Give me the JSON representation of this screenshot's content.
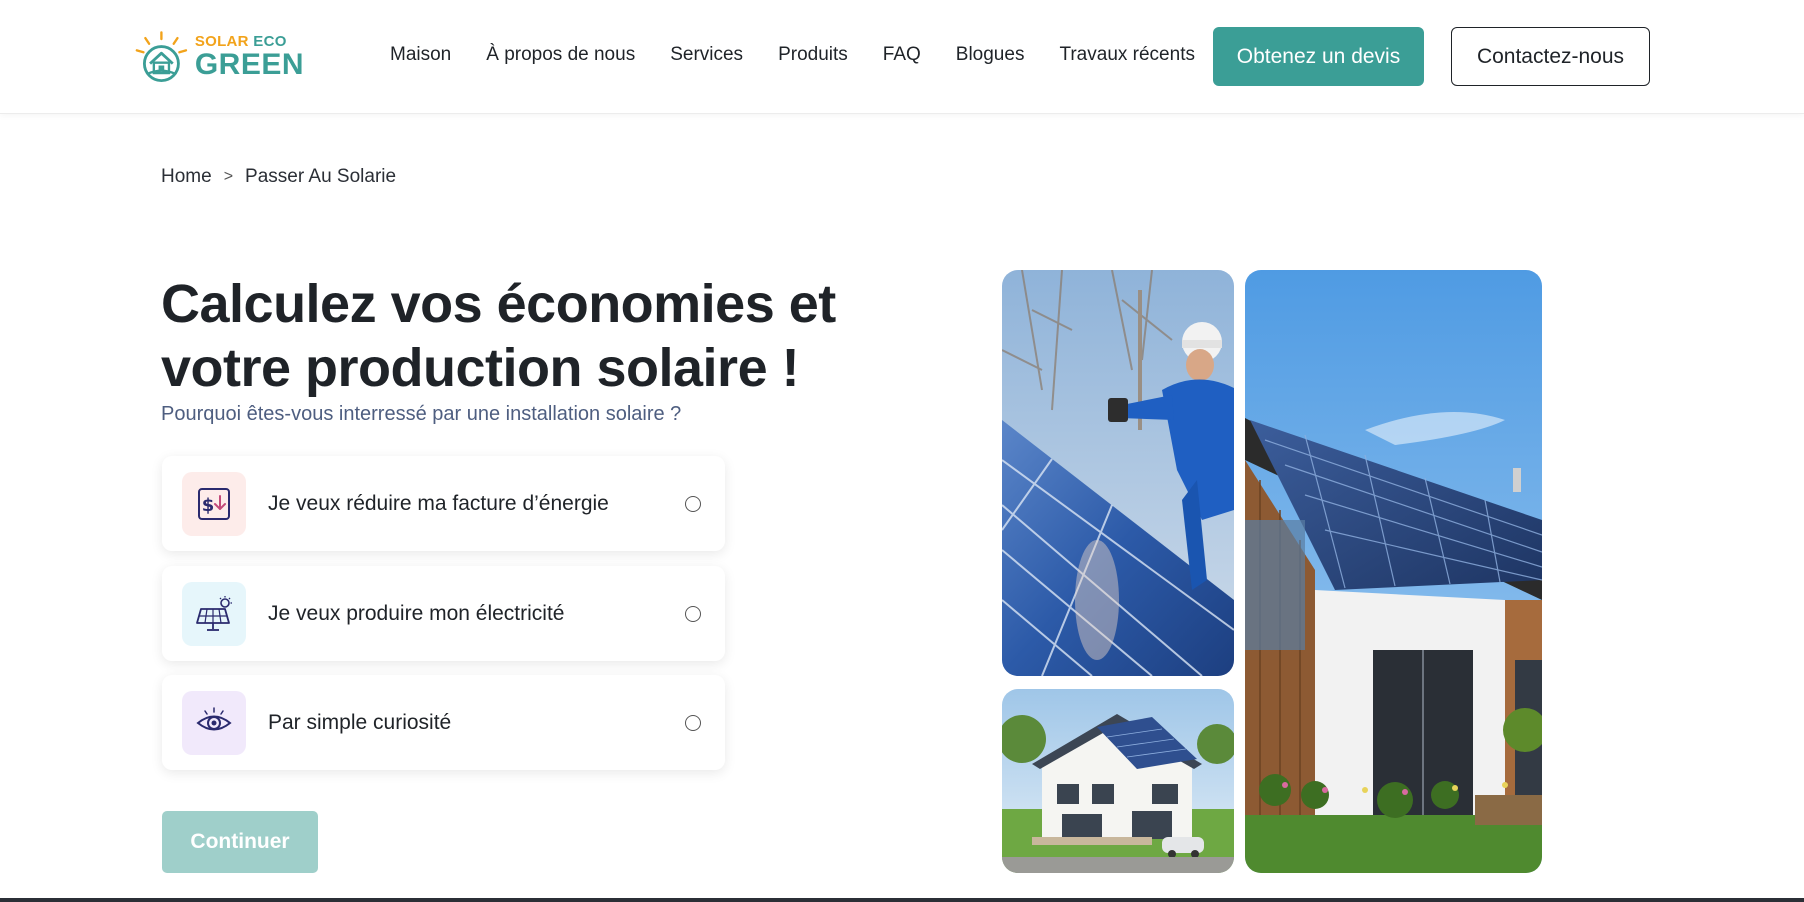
{
  "brand": {
    "logo_line1_part1": "SOLAR",
    "logo_line1_part2": "ECO",
    "logo_line2": "GREEN",
    "colors": {
      "primary": "#3b9e96",
      "accent": "#f2a31b",
      "primary_light": "#9fcfca"
    }
  },
  "nav": {
    "items": [
      {
        "label": "Maison"
      },
      {
        "label": "À propos de nous"
      },
      {
        "label": "Services"
      },
      {
        "label": "Produits"
      },
      {
        "label": "FAQ"
      },
      {
        "label": "Blogues"
      },
      {
        "label": "Travaux récents"
      }
    ],
    "quote_button": "Obtenez un devis",
    "contact_button": "Contactez-nous"
  },
  "breadcrumb": {
    "home": "Home",
    "separator": ">",
    "current": "Passer Au Solarie"
  },
  "main": {
    "title": "Calculez vos économies et votre production solaire !",
    "subtitle": "Pourquoi êtes-vous interressé par une installation solaire ?",
    "options": [
      {
        "label": "Je veux réduire ma facture d’énergie",
        "icon": "money-down-icon",
        "selected": false
      },
      {
        "label": "Je veux produire mon électricité",
        "icon": "solar-panel-icon",
        "selected": false
      },
      {
        "label": "Par simple curiosité",
        "icon": "eye-icon",
        "selected": false
      }
    ],
    "continue_button": "Continuer"
  }
}
